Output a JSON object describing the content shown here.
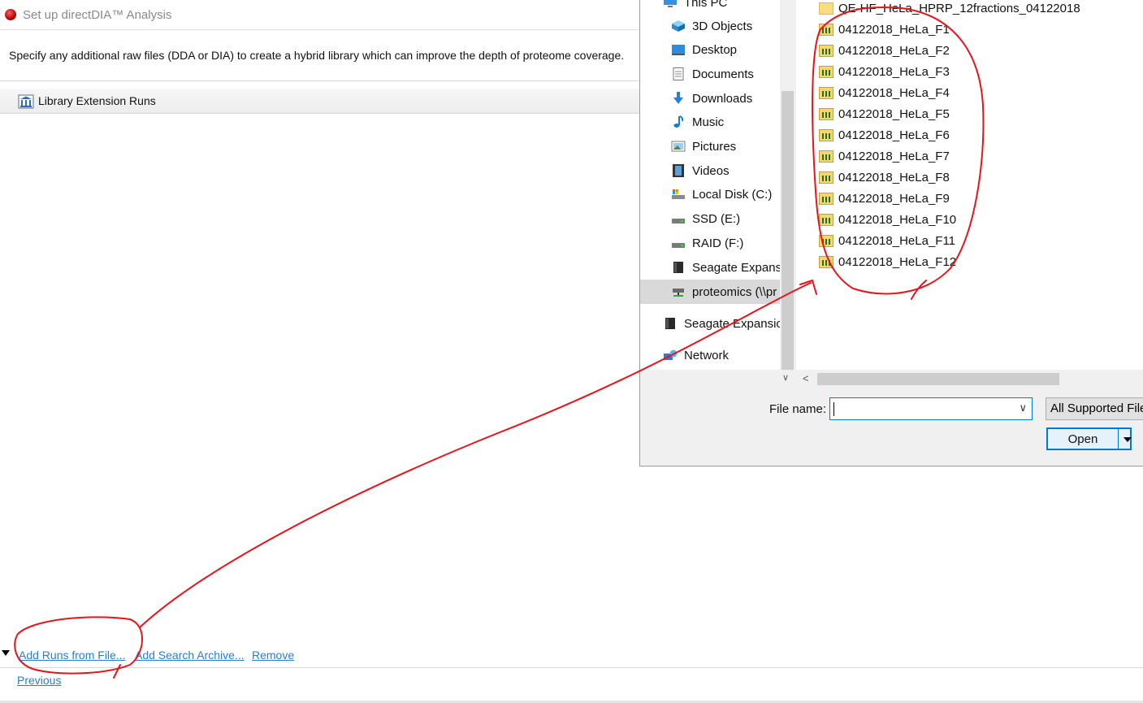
{
  "wizard": {
    "title": "Set up directDIA™ Analysis",
    "description": "Specify any additional raw files (DDA or DIA) to create a hybrid library which can improve the depth of proteome coverage.",
    "section_header": "Library Extension Runs",
    "actions": {
      "add_runs": "Add Runs from File...",
      "add_archive": "Add Search Archive...",
      "remove": "Remove"
    },
    "previous": "Previous"
  },
  "dialog": {
    "nav": {
      "items": [
        {
          "label": "This PC",
          "icon": "pc-icon"
        },
        {
          "label": "3D Objects",
          "icon": "3d-objects-icon"
        },
        {
          "label": "Desktop",
          "icon": "desktop-icon"
        },
        {
          "label": "Documents",
          "icon": "documents-icon"
        },
        {
          "label": "Downloads",
          "icon": "downloads-icon"
        },
        {
          "label": "Music",
          "icon": "music-icon"
        },
        {
          "label": "Pictures",
          "icon": "pictures-icon"
        },
        {
          "label": "Videos",
          "icon": "videos-icon"
        },
        {
          "label": "Local Disk (C:)",
          "icon": "local-disk-icon"
        },
        {
          "label": "SSD (E:)",
          "icon": "drive-icon"
        },
        {
          "label": "RAID (F:)",
          "icon": "drive-icon"
        },
        {
          "label": "Seagate Expansio",
          "icon": "external-drive-icon"
        },
        {
          "label": "proteomics (\\\\pr",
          "icon": "network-drive-icon"
        },
        {
          "label": "Seagate Expansion",
          "icon": "external-drive-icon"
        },
        {
          "label": "Network",
          "icon": "network-icon"
        }
      ],
      "selected_index": 12
    },
    "files": [
      {
        "name": "QE-HF_HeLa_HPRP_12fractions_04122018",
        "icon": "folder-icon"
      },
      {
        "name": "04122018_HeLa_F1",
        "icon": "raw-file-folder-icon"
      },
      {
        "name": "04122018_HeLa_F2",
        "icon": "raw-file-folder-icon"
      },
      {
        "name": "04122018_HeLa_F3",
        "icon": "raw-file-folder-icon"
      },
      {
        "name": "04122018_HeLa_F4",
        "icon": "raw-file-folder-icon"
      },
      {
        "name": "04122018_HeLa_F5",
        "icon": "raw-file-folder-icon"
      },
      {
        "name": "04122018_HeLa_F6",
        "icon": "raw-file-folder-icon"
      },
      {
        "name": "04122018_HeLa_F7",
        "icon": "raw-file-folder-icon"
      },
      {
        "name": "04122018_HeLa_F8",
        "icon": "raw-file-folder-icon"
      },
      {
        "name": "04122018_HeLa_F9",
        "icon": "raw-file-folder-icon"
      },
      {
        "name": "04122018_HeLa_F10",
        "icon": "raw-file-folder-icon"
      },
      {
        "name": "04122018_HeLa_F11",
        "icon": "raw-file-folder-icon"
      },
      {
        "name": "04122018_HeLa_F12",
        "icon": "raw-file-folder-icon"
      }
    ],
    "file_name_label": "File name:",
    "file_name_value": "",
    "filter": "All Supported Files",
    "open_button": "Open"
  },
  "annotation_color": "#e8141b"
}
